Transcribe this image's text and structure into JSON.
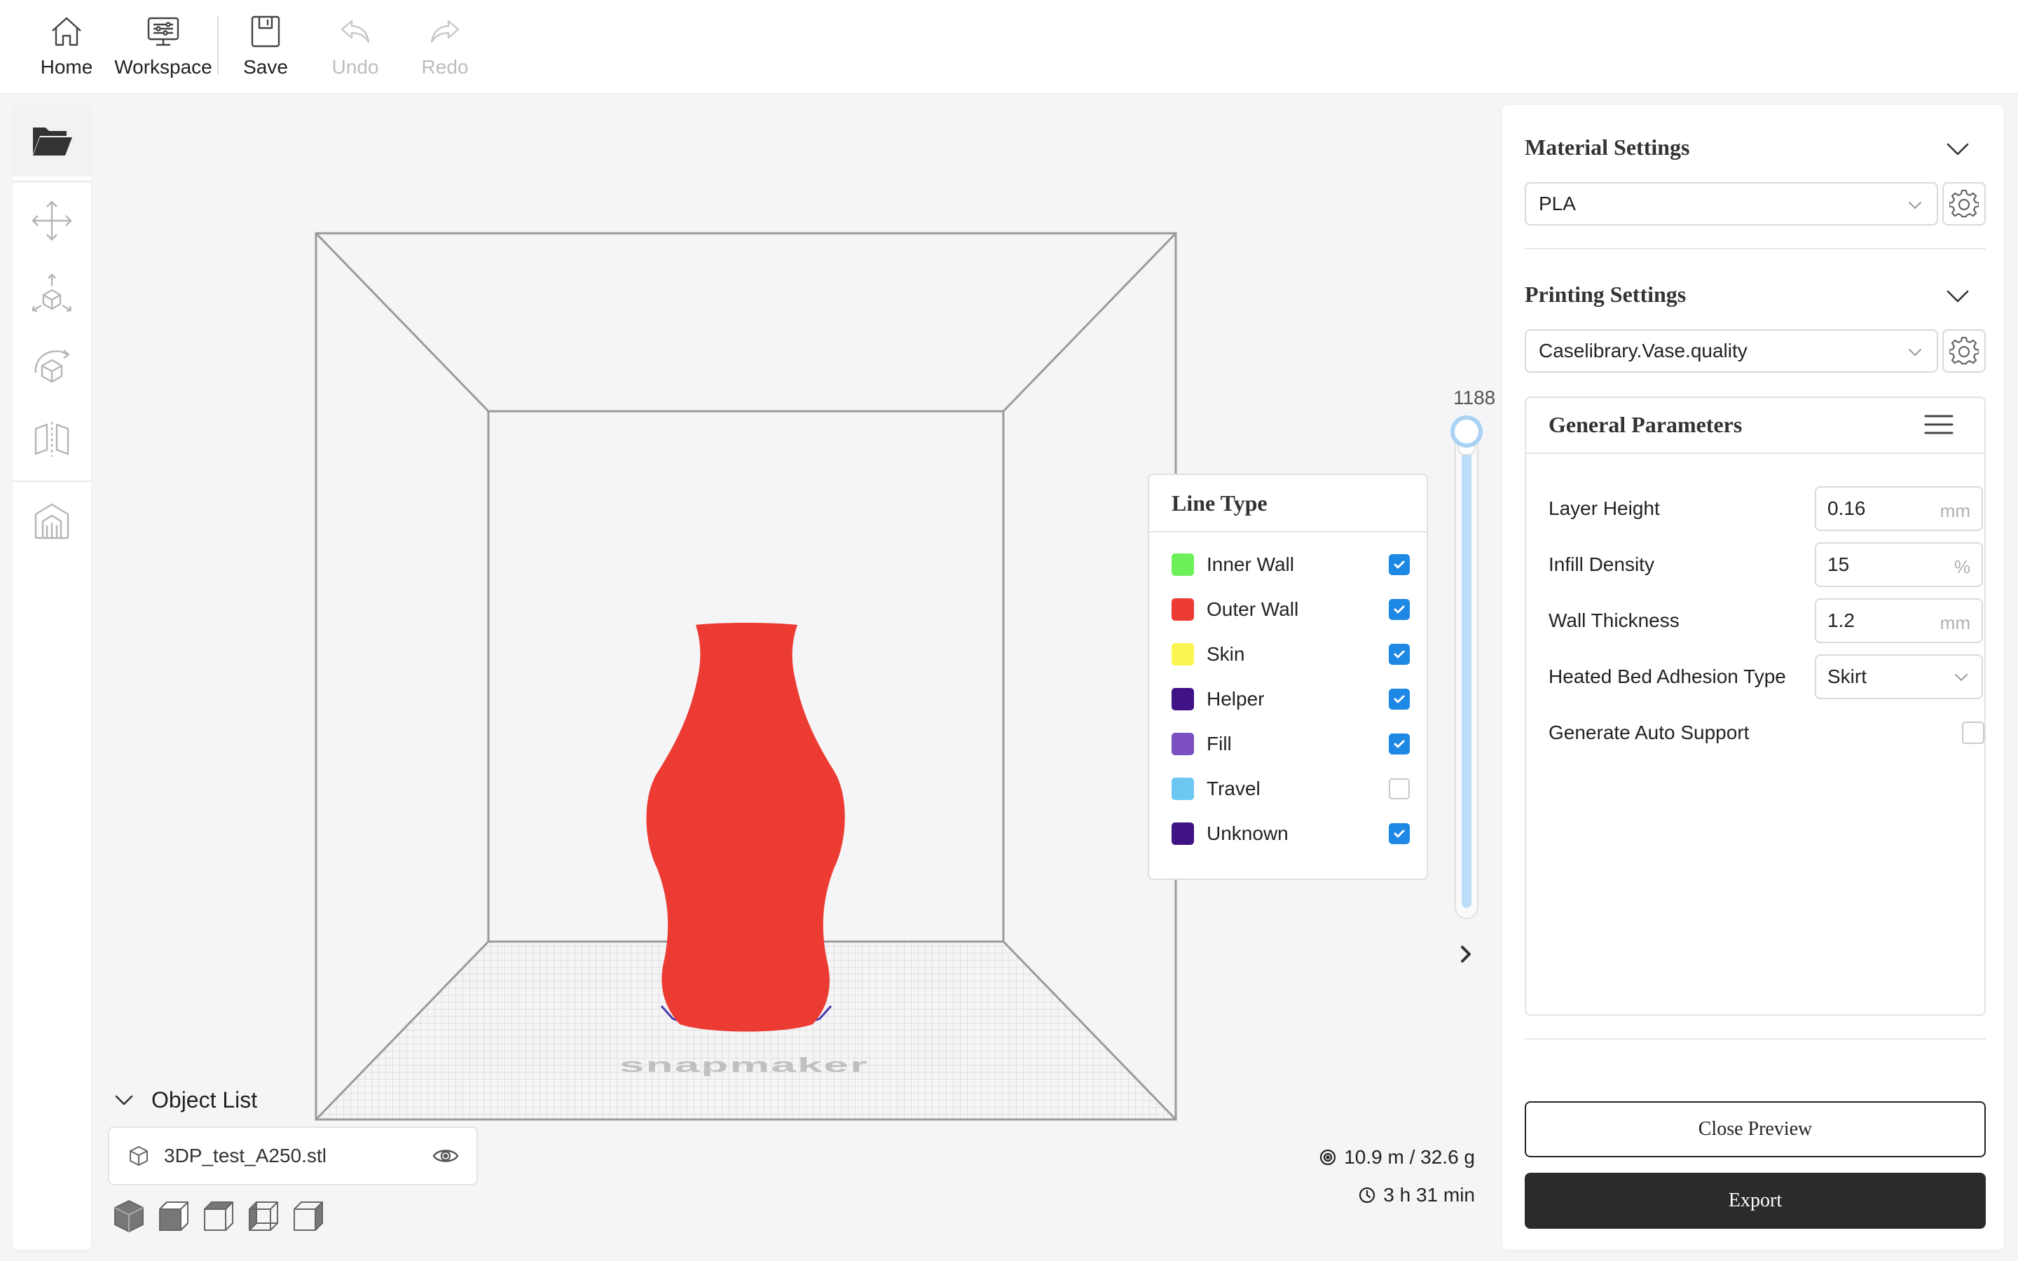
{
  "toolbar": {
    "home_label": "Home",
    "workspace_label": "Workspace",
    "save_label": "Save",
    "undo_label": "Undo",
    "redo_label": "Redo"
  },
  "left_tools": [
    "folder-open-icon",
    "move-icon",
    "scale-icon",
    "rotate-icon",
    "mirror-icon",
    "support-icon"
  ],
  "scene": {
    "watermark": "snapmaker",
    "model_color": "#ec3b33",
    "outline_color": "#4a3ab0"
  },
  "line_type": {
    "title": "Line Type",
    "items": [
      {
        "label": "Inner Wall",
        "color": "#6df05a",
        "checked": true
      },
      {
        "label": "Outer Wall",
        "color": "#ec3b33",
        "checked": true
      },
      {
        "label": "Skin",
        "color": "#fbf551",
        "checked": true
      },
      {
        "label": "Helper",
        "color": "#3f1285",
        "checked": true
      },
      {
        "label": "Fill",
        "color": "#7c4fc0",
        "checked": true
      },
      {
        "label": "Travel",
        "color": "#6cc7f3",
        "checked": false
      },
      {
        "label": "Unknown",
        "color": "#3f1285",
        "checked": true
      }
    ]
  },
  "layer_slider": {
    "value": "1188",
    "level_fraction": 0.96
  },
  "object_list": {
    "title": "Object List",
    "items": [
      {
        "name": "3DP_test_A250.stl"
      }
    ]
  },
  "view_icons": [
    "iso-view-icon",
    "front-view-icon",
    "top-view-icon",
    "left-view-icon",
    "right-view-icon"
  ],
  "stats": {
    "filament": "10.9 m / 32.6 g",
    "time": "3 h 31 min"
  },
  "material_settings": {
    "title": "Material Settings",
    "selected": "PLA"
  },
  "printing_settings": {
    "title": "Printing Settings",
    "selected": "Caselibrary.Vase.quality"
  },
  "general_parameters": {
    "title": "General Parameters",
    "layer_height": {
      "label": "Layer Height",
      "value": "0.16",
      "unit": "mm"
    },
    "infill_density": {
      "label": "Infill Density",
      "value": "15",
      "unit": "%"
    },
    "wall_thickness": {
      "label": "Wall Thickness",
      "value": "1.2",
      "unit": "mm"
    },
    "adhesion": {
      "label": "Heated Bed Adhesion Type",
      "value": "Skirt"
    },
    "auto_support": {
      "label": "Generate Auto Support",
      "checked": false
    }
  },
  "actions": {
    "close_preview": "Close Preview",
    "export": "Export"
  },
  "colors": {
    "accent": "#1e88e5",
    "export_bg": "#2b2b2b",
    "slider_fill": "#bcdcf7"
  }
}
